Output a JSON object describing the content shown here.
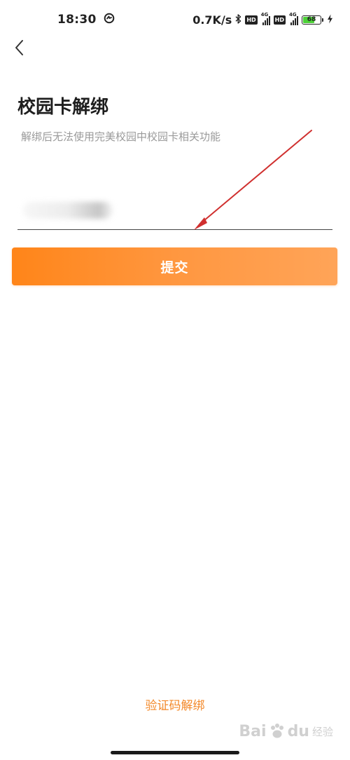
{
  "status_bar": {
    "time": "18:30",
    "net_speed": "0.7K/s",
    "hd_label": "HD",
    "network_type": "4G",
    "battery_level": "68",
    "battery_percent": 68
  },
  "page": {
    "title": "校园卡解绑",
    "subtitle": "解绑后无法使用完美校园中校园卡相关功能"
  },
  "card_input": {
    "value": ""
  },
  "submit_button": {
    "label": "提交",
    "color_start": "#ff8519",
    "color_end": "#ffa458"
  },
  "verify_link": {
    "label": "验证码解绑",
    "color": "#f3892a"
  },
  "watermark": {
    "brand": "Bai",
    "brand_suffix": "du",
    "sub": "经验"
  },
  "annotation": {
    "color": "#d0302f"
  }
}
